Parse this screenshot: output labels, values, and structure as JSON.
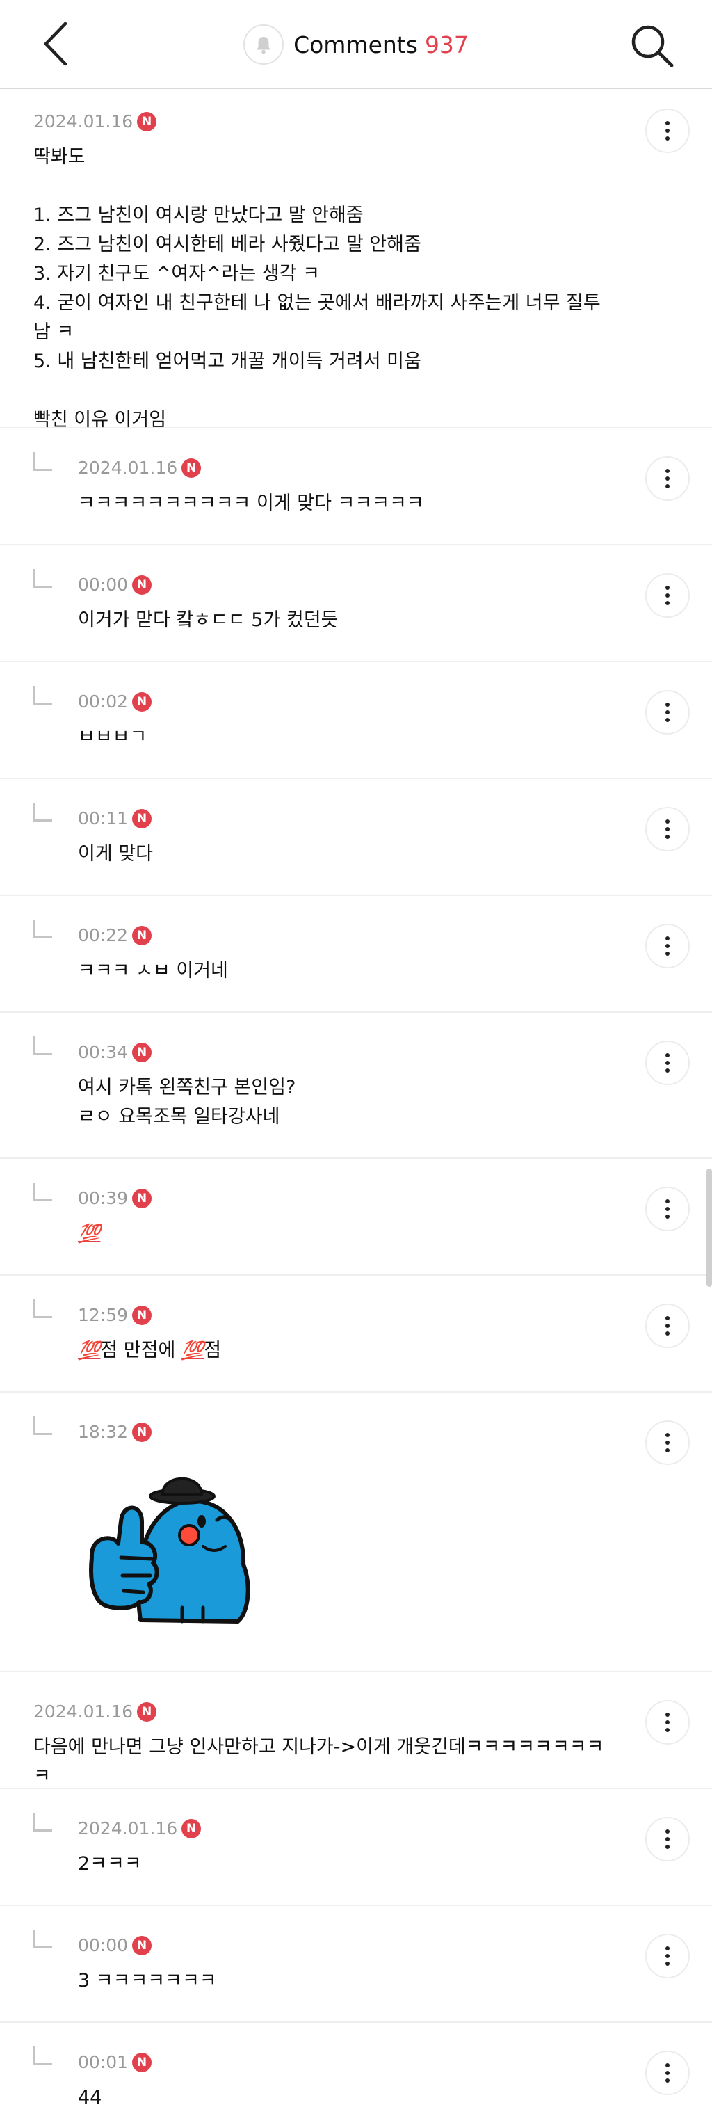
{
  "header": {
    "title": "Comments",
    "count": "937"
  },
  "icons": {
    "back": "chevron-left-icon",
    "notification": "bell-icon",
    "search": "search-icon",
    "more": "more-vertical-icon",
    "new_badge": "new-badge"
  },
  "colors": {
    "accent": "#e0414d",
    "date_text": "#999999",
    "divider": "#eeeeee",
    "character_blue": "#1a9ad8"
  },
  "new_badge_label": "N",
  "comments": [
    {
      "date": "2024.01.16",
      "text": "딱봐도\n\n1. 즈그 남친이 여시랑 만났다고 말 안해줌\n2. 즈그 남친이 여시한테 베라 사줬다고 말 안해줌\n3. 자기 친구도 ^여자^라는 생각 ㅋ\n4. 굳이 여자인 내 친구한테 나 없는 곳에서 배라까지 사주는게 너무 질투남 ㅋ\n5. 내 남친한테 얻어먹고 개꿀 개이득 거려서 미움\n\n빡친 이유 이거임",
      "replies": [
        {
          "date": "2024.01.16",
          "text": "ㅋㅋㅋㅋㅋㅋㅋㅋㅋㅋ 이게 맞다 ㅋㅋㅋㅋㅋ"
        },
        {
          "date": "00:00",
          "text": "이거가 맏다 캌ㅎㄷㄷ 5가 컸던듯"
        },
        {
          "date": "00:02",
          "text": "ㅂㅂㅂㄱ"
        },
        {
          "date": "00:11",
          "text": "이게 맞다"
        },
        {
          "date": "00:22",
          "text": "ㅋㅋㅋ ㅅㅂ 이거네"
        },
        {
          "date": "00:34",
          "text": "여시 카톡 왼쪽친구 본인임?\nㄹㅇ 요목조목 일타강사네"
        },
        {
          "date": "00:39",
          "emoji": "💯"
        },
        {
          "date": "12:59",
          "emoji": "💯",
          "text_a": "점 만점에 ",
          "text_b": "점"
        },
        {
          "date": "18:32",
          "sticker": "blue-character-thumbs-up-sticker"
        }
      ]
    },
    {
      "date": "2024.01.16",
      "text": "다음에 만나면 그냥 인사만하고 지나가->이게 개웃긴데ㅋㅋㅋㅋㅋㅋㅋㅋㅋ",
      "replies": [
        {
          "date": "2024.01.16",
          "text": "2ㅋㅋㅋ"
        },
        {
          "date": "00:00",
          "text": "3 ㅋㅋㅋㅋㅋㅋㅋ"
        },
        {
          "date": "00:01",
          "text": "44"
        }
      ]
    }
  ]
}
